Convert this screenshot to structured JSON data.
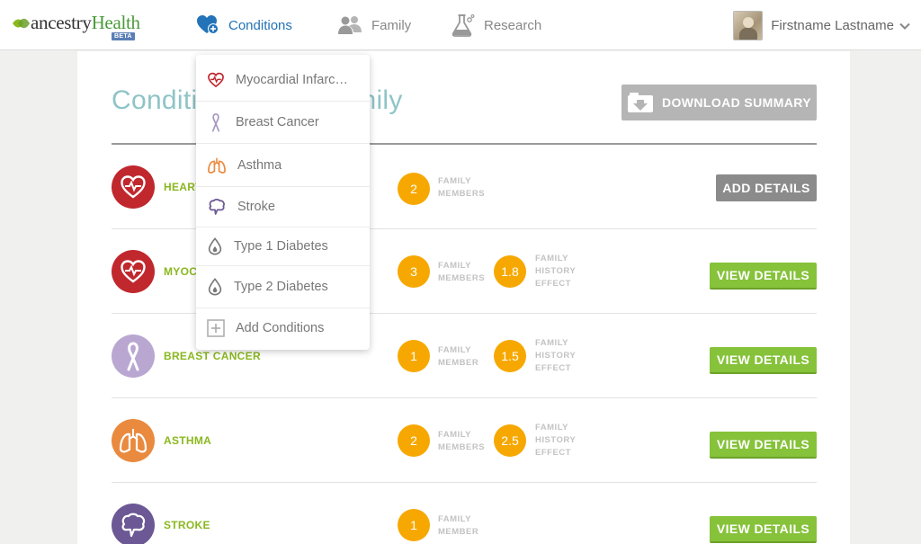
{
  "brand": {
    "name_part1": "ancestry",
    "name_part2": "Health",
    "badge": "BETA"
  },
  "nav": {
    "conditions": "Conditions",
    "family": "Family",
    "research": "Research"
  },
  "user": {
    "name": "Firstname Lastname"
  },
  "page": {
    "title_visible_left": "Conditi",
    "title_visible_right": "nily",
    "download_label": "DOWNLOAD SUMMARY"
  },
  "conditions_menu": [
    {
      "label": "Myocardial Infarc…",
      "icon": "heart-ecg-icon"
    },
    {
      "label": "Breast Cancer",
      "icon": "ribbon-icon"
    },
    {
      "label": "Asthma",
      "icon": "lungs-icon"
    },
    {
      "label": "Stroke",
      "icon": "brain-icon"
    },
    {
      "label": "Type 1 Diabetes",
      "icon": "drop-icon"
    },
    {
      "label": "Type 2 Diabetes",
      "icon": "drop-icon"
    },
    {
      "label": "Add Conditions",
      "icon": "plus-square-icon"
    }
  ],
  "rows": [
    {
      "name": "HEART",
      "members_count": "2",
      "members_label_1": "FAMILY",
      "members_label_2": "MEMBERS",
      "button": "ADD DETAILS"
    },
    {
      "name": "MYOCA",
      "members_count": "3",
      "members_label_1": "FAMILY",
      "members_label_2": "MEMBERS",
      "effect": "1.8",
      "effect_label_1": "FAMILY",
      "effect_label_2": "HISTORY",
      "effect_label_3": "EFFECT",
      "button": "VIEW DETAILS"
    },
    {
      "name": "BREAST CANCER",
      "members_count": "1",
      "members_label_1": "FAMILY",
      "members_label_2": "MEMBER",
      "effect": "1.5",
      "effect_label_1": "FAMILY",
      "effect_label_2": "HISTORY",
      "effect_label_3": "EFFECT",
      "button": "VIEW DETAILS"
    },
    {
      "name": "ASTHMA",
      "members_count": "2",
      "members_label_1": "FAMILY",
      "members_label_2": "MEMBERS",
      "effect": "2.5",
      "effect_label_1": "FAMILY",
      "effect_label_2": "HISTORY",
      "effect_label_3": "EFFECT",
      "button": "VIEW DETAILS"
    },
    {
      "name": "STROKE",
      "members_count": "1",
      "members_label_1": "FAMILY",
      "members_label_2": "MEMBER",
      "button": "VIEW DETAILS"
    }
  ],
  "colors": {
    "accent_blue": "#2273b8",
    "green": "#86c23a",
    "orange_badge": "#f7a800",
    "heart_red": "#c0282e",
    "ribbon_lilac": "#b9a7d2",
    "asthma_orange": "#e98a3f",
    "stroke_purple": "#6b5894"
  }
}
